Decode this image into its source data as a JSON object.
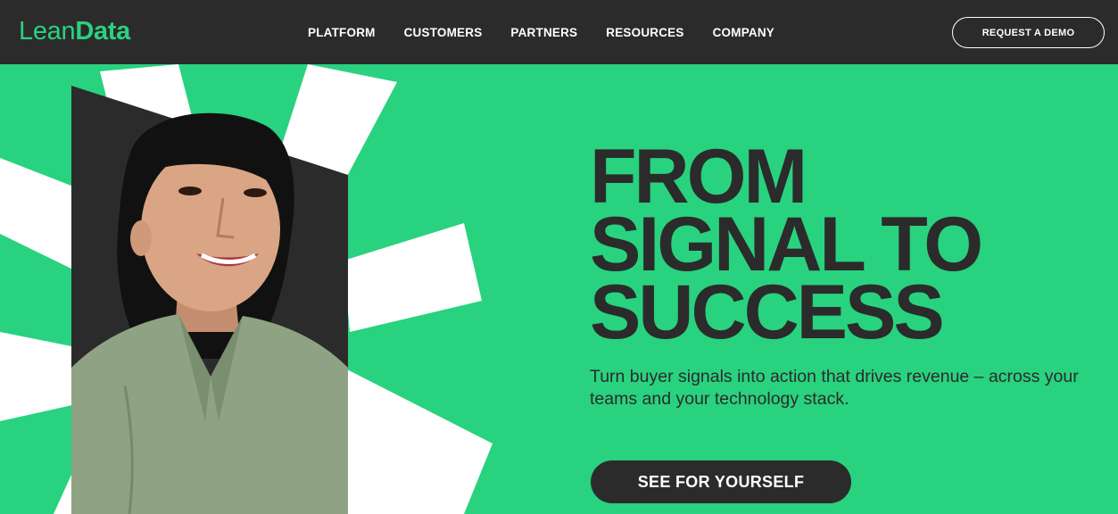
{
  "brand": {
    "logo_light": "Lean",
    "logo_bold": "Data"
  },
  "nav": {
    "items": [
      {
        "label": "PLATFORM"
      },
      {
        "label": "CUSTOMERS"
      },
      {
        "label": "PARTNERS"
      },
      {
        "label": "RESOURCES"
      },
      {
        "label": "COMPANY"
      }
    ],
    "demo_label": "REQUEST A DEMO"
  },
  "hero": {
    "headline": [
      "FROM",
      "SIGNAL TO",
      "SUCCESS"
    ],
    "subtext": "Turn buyer signals into action that drives revenue – across your teams and your technology stack.",
    "cta_label": "SEE FOR YOURSELF"
  },
  "colors": {
    "brand_green": "#29d27f",
    "dark": "#2b2b2b",
    "white": "#ffffff"
  }
}
